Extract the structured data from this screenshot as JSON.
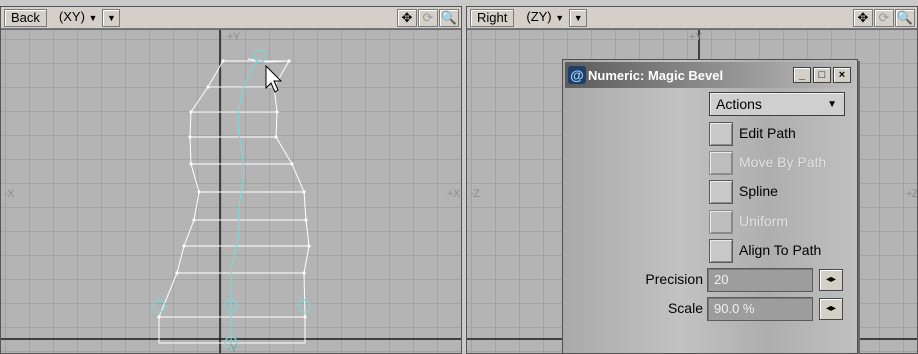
{
  "viewport_back": {
    "name": "Back",
    "projection": "(XY)",
    "dropdown_arrow": "▼",
    "tools": {
      "move": "✥",
      "rotate": "⟳",
      "zoom": "🔍"
    },
    "axis_top": "+Y",
    "axis_bottom": "-Y",
    "axis_left": "-X",
    "axis_right": "+X"
  },
  "viewport_right": {
    "name": "Right",
    "projection": "(ZY)",
    "dropdown_arrow": "▼",
    "tools": {
      "move": "✥",
      "rotate": "⟳",
      "zoom": "🔍"
    },
    "axis_top": "+Y",
    "axis_left": "-Z",
    "axis_right": "+Z"
  },
  "dialog": {
    "title": "Numeric: Magic Bevel",
    "logo_glyph": "@",
    "window_buttons": {
      "minimize": "_",
      "maximize": "□",
      "close": "×"
    },
    "actions_label": "Actions",
    "actions_arrow": "▼",
    "options": [
      {
        "label": "Edit Path",
        "enabled": true,
        "checked": false
      },
      {
        "label": "Move By Path",
        "enabled": false,
        "checked": false
      },
      {
        "label": "Spline",
        "enabled": true,
        "checked": false
      },
      {
        "label": "Uniform",
        "enabled": false,
        "checked": false
      },
      {
        "label": "Align To Path",
        "enabled": true,
        "checked": false
      }
    ],
    "precision_label": "Precision",
    "precision_value": "20",
    "scale_label": "Scale",
    "scale_value": "90.0 %",
    "stepper_glyph": "◂▸"
  },
  "colors": {
    "mesh": "#ffffff",
    "path": "#7fd6d6",
    "axis": "#1a1a1a",
    "canvas": "#b4b4b4"
  },
  "icons": [
    "move-icon",
    "rotate-icon",
    "zoom-icon",
    "mouse-cursor-icon",
    "magic-bevel-logo-icon"
  ]
}
